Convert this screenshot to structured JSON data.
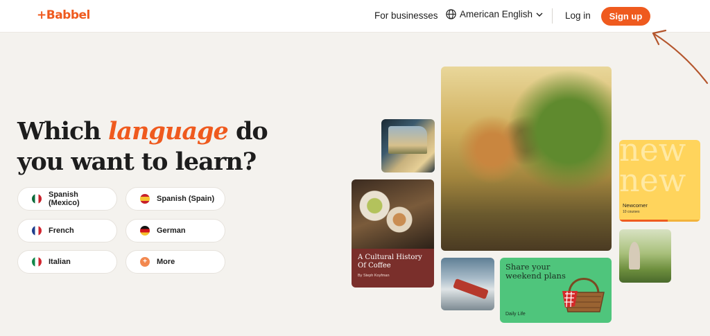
{
  "header": {
    "logo": "+Babbel",
    "for_businesses": "For businesses",
    "language": "American English",
    "login": "Log in",
    "signup": "Sign up"
  },
  "headline": {
    "before": "Which ",
    "emphasis": "language",
    "after": " do",
    "line2": "you want to learn?"
  },
  "languages": [
    {
      "label": "Spanish (Mexico)",
      "flag": "mexico-flag-icon"
    },
    {
      "label": "Spanish (Spain)",
      "flag": "spain-flag-icon"
    },
    {
      "label": "French",
      "flag": "france-flag-icon"
    },
    {
      "label": "German",
      "flag": "germany-flag-icon"
    },
    {
      "label": "Italian",
      "flag": "italy-flag-icon"
    },
    {
      "label": "More",
      "flag": "plus-icon"
    }
  ],
  "cards": {
    "coffee_title": "A Cultural History Of Coffee",
    "coffee_author": "By Steph Koyfman",
    "weekend_title": "Share your weekend plans",
    "weekend_tag": "Daily Life",
    "newcomer_bg": "new",
    "newcomer_title": "Newcomer",
    "newcomer_sub": "10 courses",
    "newcomer_progress": 0.6
  },
  "colors": {
    "brand": "#ef5a1e",
    "coffee_card": "#7a2f2b",
    "green_card": "#4fc57c",
    "yellow_card": "#ffd45c"
  }
}
